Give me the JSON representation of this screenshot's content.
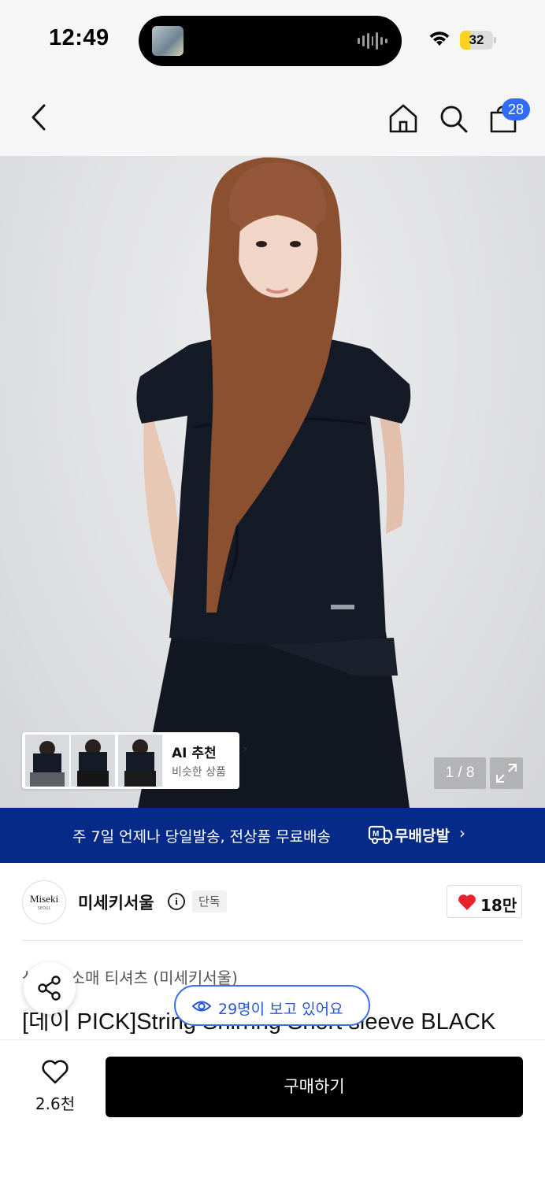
{
  "status_bar": {
    "time": "12:49",
    "battery_level": "32",
    "battery_fraction": 0.32,
    "icons": [
      "now-playing-thumbnail",
      "audio-waveform-icon",
      "wifi-icon",
      "battery-icon"
    ]
  },
  "header": {
    "icons": [
      "back-icon",
      "home-icon",
      "search-icon",
      "shopping-bag-icon"
    ],
    "cart_count": "28",
    "badge_color": "#2f6df6"
  },
  "gallery": {
    "ai_recommend_title": "AI 추천",
    "ai_recommend_subtitle": "비슷한 상품",
    "page_indicator": "1 / 8"
  },
  "promo_banner": {
    "text": "주 7일 언제나 당일발송, 전상품 무료배송",
    "brand": "무배당발",
    "background": "#062a87"
  },
  "seller": {
    "logo_text": "Miseki",
    "logo_subtext": "SEOUL",
    "name": "미세키서울",
    "badge": "단독",
    "like_count": "18만"
  },
  "product": {
    "category": "상의 반소매 티셔츠 (미세키서울)",
    "title": "[데이 PICK]String Shirring Short sleeve BLACK",
    "live_viewers": "29명이 보고 있어요"
  },
  "bottom_bar": {
    "like_count": "2.6천",
    "buy_label": "구매하기"
  }
}
